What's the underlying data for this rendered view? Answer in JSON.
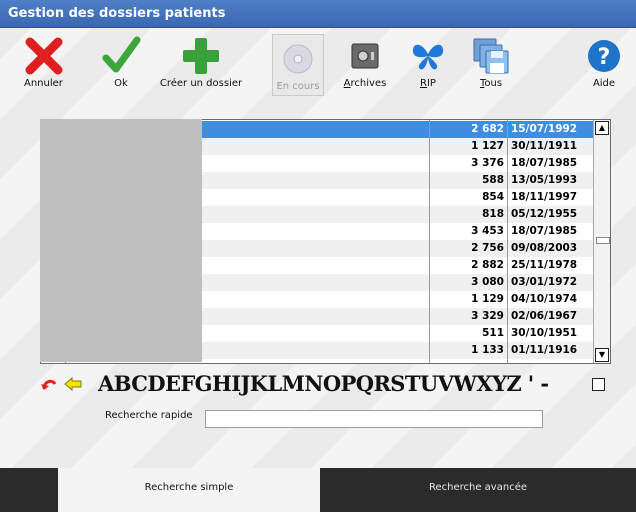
{
  "window": {
    "title": "Gestion des dossiers patients"
  },
  "toolbar": {
    "annuler": "Annuler",
    "ok": "Ok",
    "creer": "Créer un dossier",
    "en_cours": "En cours",
    "archives": "Archives",
    "rip": "RIP",
    "tous": "Tous",
    "aide": "Aide"
  },
  "patients": [
    {
      "number": "2 682",
      "date": "15/07/1992",
      "flag": true
    },
    {
      "number": "1 127",
      "date": "30/11/1911",
      "flag": false
    },
    {
      "number": "3 376",
      "date": "18/07/1985",
      "flag": true
    },
    {
      "number": "588",
      "date": "13/05/1993",
      "flag": false
    },
    {
      "number": "854",
      "date": "18/11/1997",
      "flag": false
    },
    {
      "number": "818",
      "date": "05/12/1955",
      "flag": false
    },
    {
      "number": "3 453",
      "date": "18/07/1985",
      "flag": true
    },
    {
      "number": "2 756",
      "date": "09/08/2003",
      "flag": false
    },
    {
      "number": "2 882",
      "date": "25/11/1978",
      "flag": false
    },
    {
      "number": "3 080",
      "date": "03/01/1972",
      "flag": false
    },
    {
      "number": "1 129",
      "date": "04/10/1974",
      "flag": false
    },
    {
      "number": "3 329",
      "date": "02/06/1967",
      "flag": false
    },
    {
      "number": "511",
      "date": "30/10/1951",
      "flag": false
    },
    {
      "number": "1 133",
      "date": "01/11/1916",
      "flag": false
    }
  ],
  "alphabet": "ABCDEFGHIJKLMNOPQRSTUVWXYZ ' -",
  "search": {
    "label": "Recherche rapide",
    "value": ""
  },
  "tabs": {
    "simple": "Recherche simple",
    "avancee": "Recherche avancée"
  },
  "colors": {
    "title_bar": "#3a67b3",
    "selection": "#3d8ee0",
    "cancel": "#e02020",
    "ok": "#2f9a2f",
    "help": "#1f74c8"
  }
}
